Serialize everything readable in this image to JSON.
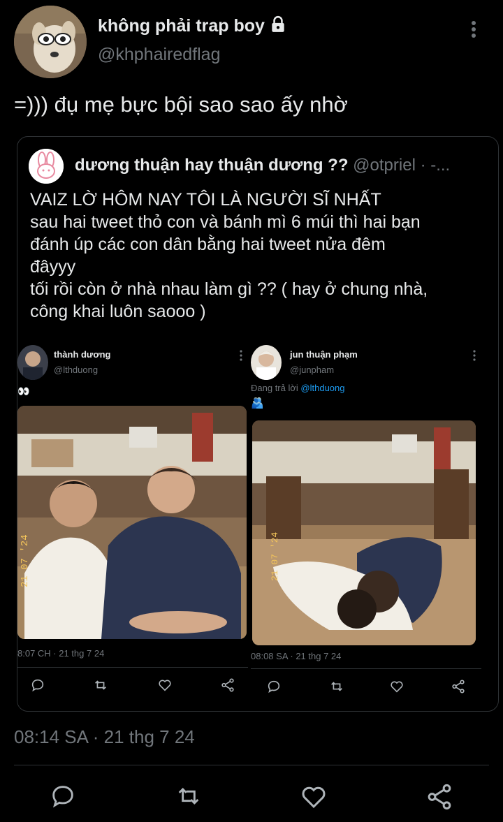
{
  "tweet": {
    "display_name": "không phải trap boy",
    "handle": "@khphairedflag",
    "text": "=))) đụ mẹ bực bội sao sao ấy nhờ",
    "timestamp": "08:14 SA · 21 thg 7 24"
  },
  "quote": {
    "display_name": "dương thuận hay thuận dương ??",
    "handle_meta": "@otpriel · -...",
    "text_lines": [
      "VAIZ LỜ HÔM NAY TÔI LÀ NGƯỜI SĨ NHẤT",
      "sau hai tweet thỏ con và bánh mì 6 múi thì hai bạn",
      "đánh úp các con dân bằng hai tweet nửa đêm",
      "đâyyy",
      "tối rồi còn ở nhà nhau làm gì ?? ( hay ở chung nhà,",
      "công khai luôn saooo )"
    ]
  },
  "embedded_left": {
    "display_name": "thành dương",
    "handle": "@lthduong",
    "text": "👀",
    "time": "8:07 CH · 21 thg 7 24"
  },
  "embedded_right": {
    "display_name": "jun thuận phạm",
    "handle": "@junpham",
    "reply_prefix": "Đang trả lời",
    "reply_handle": "@lthduong",
    "text": "🫂",
    "time": "08:08 SA · 21 thg 7 24"
  },
  "icons": {
    "lock": "lock-icon",
    "more": "more-vertical-icon",
    "reply": "reply-icon",
    "retweet": "retweet-icon",
    "like": "heart-icon",
    "share": "share-icon"
  },
  "colors": {
    "background": "#000000",
    "text": "#e7e9ea",
    "muted": "#71767b",
    "border": "#2f3336",
    "link": "#1d9bf0"
  }
}
